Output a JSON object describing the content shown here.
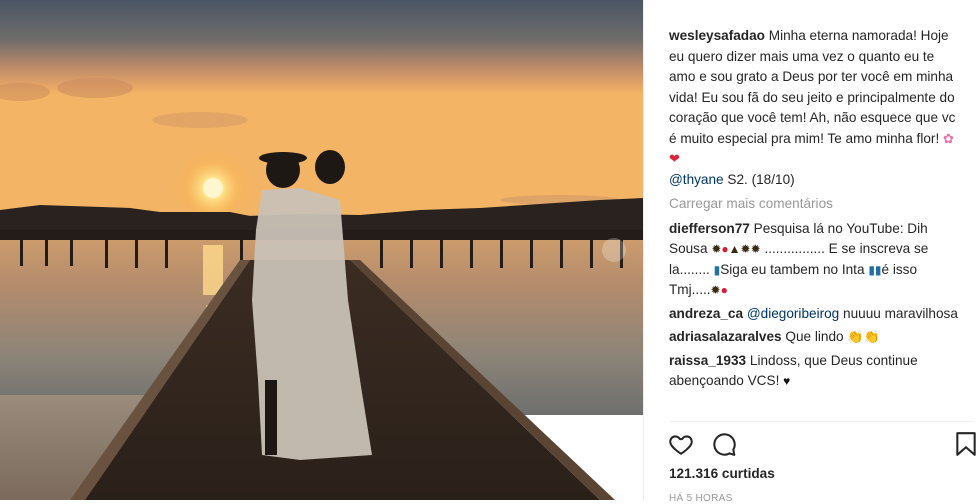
{
  "post": {
    "author": "wesleysafadao",
    "caption_text": "Minha eterna namorada! Hoje eu quero dizer mais uma vez o quanto eu te amo e sou grato a Deus por ter você em minha vida! Eu sou fã do seu jeito e principalmente do coração que você tem! Ah, não esquece que vc é muito especial pra mim! Te amo minha flor!",
    "caption_emojis": [
      "pink-flower",
      "red-heart"
    ],
    "caption_mention": "@thyane",
    "caption_suffix": " S2. (18/10)",
    "load_more_label": "Carregar mais comentários",
    "comments": [
      {
        "user": "diefferson77",
        "text_1": "Pesquisa lá no YouTube: Dih Sousa",
        "text_2": "................ E se inscreva se la........",
        "text_3": "Siga eu tambem no Inta",
        "text_4": "é isso Tmj....."
      },
      {
        "user": "andreza_ca",
        "mention": "@diegoribeirog",
        "text": "nuuuu maravilhosa"
      },
      {
        "user": "adriasalazaralves",
        "text": "Que lindo",
        "emojis": [
          "clapping-hands",
          "clapping-hands"
        ]
      },
      {
        "user": "raissa_1933",
        "text": "Lindoss, que Deus continue abençoando VCS!",
        "emojis": [
          "black-heart"
        ]
      }
    ],
    "likes_label": "121.316 curtidas",
    "time_label": "HÁ 5 HORAS"
  },
  "icons": {
    "like": "heart-outline-icon",
    "comment": "speech-bubble-icon",
    "save": "bookmark-icon"
  },
  "colors": {
    "text": "#262626",
    "muted": "#999999",
    "mention": "#003569",
    "divider": "#efefef"
  }
}
